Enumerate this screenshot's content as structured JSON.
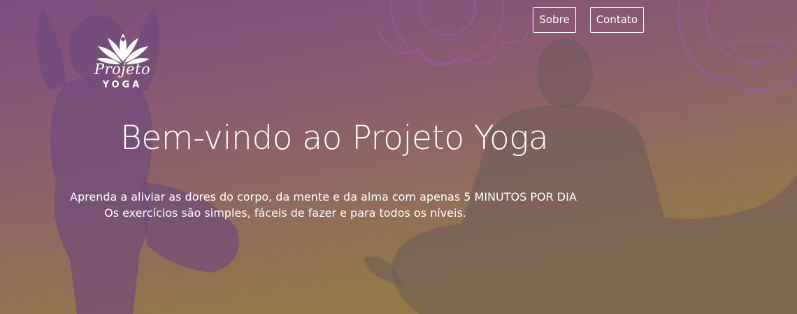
{
  "colors": {
    "text": "#ffffff",
    "accent_purple": "#7a4d7e",
    "accent_gold": "#8f7a3c"
  },
  "header": {
    "logo": {
      "icon": "lotus-icon",
      "script_text": "Projeto",
      "word_text": "YOGA"
    },
    "nav": [
      {
        "label": "Sobre"
      },
      {
        "label": "Contato"
      }
    ]
  },
  "hero": {
    "title": "Bem-vindo ao Projeto Yoga",
    "subtitle_line1": "Aprenda a aliviar as dores do corpo, da mente e da alma com apenas 5 MINUTOS POR DIA",
    "subtitle_line2": "Os exercícios são simples, fáceis de fazer e para todos os níveis."
  }
}
